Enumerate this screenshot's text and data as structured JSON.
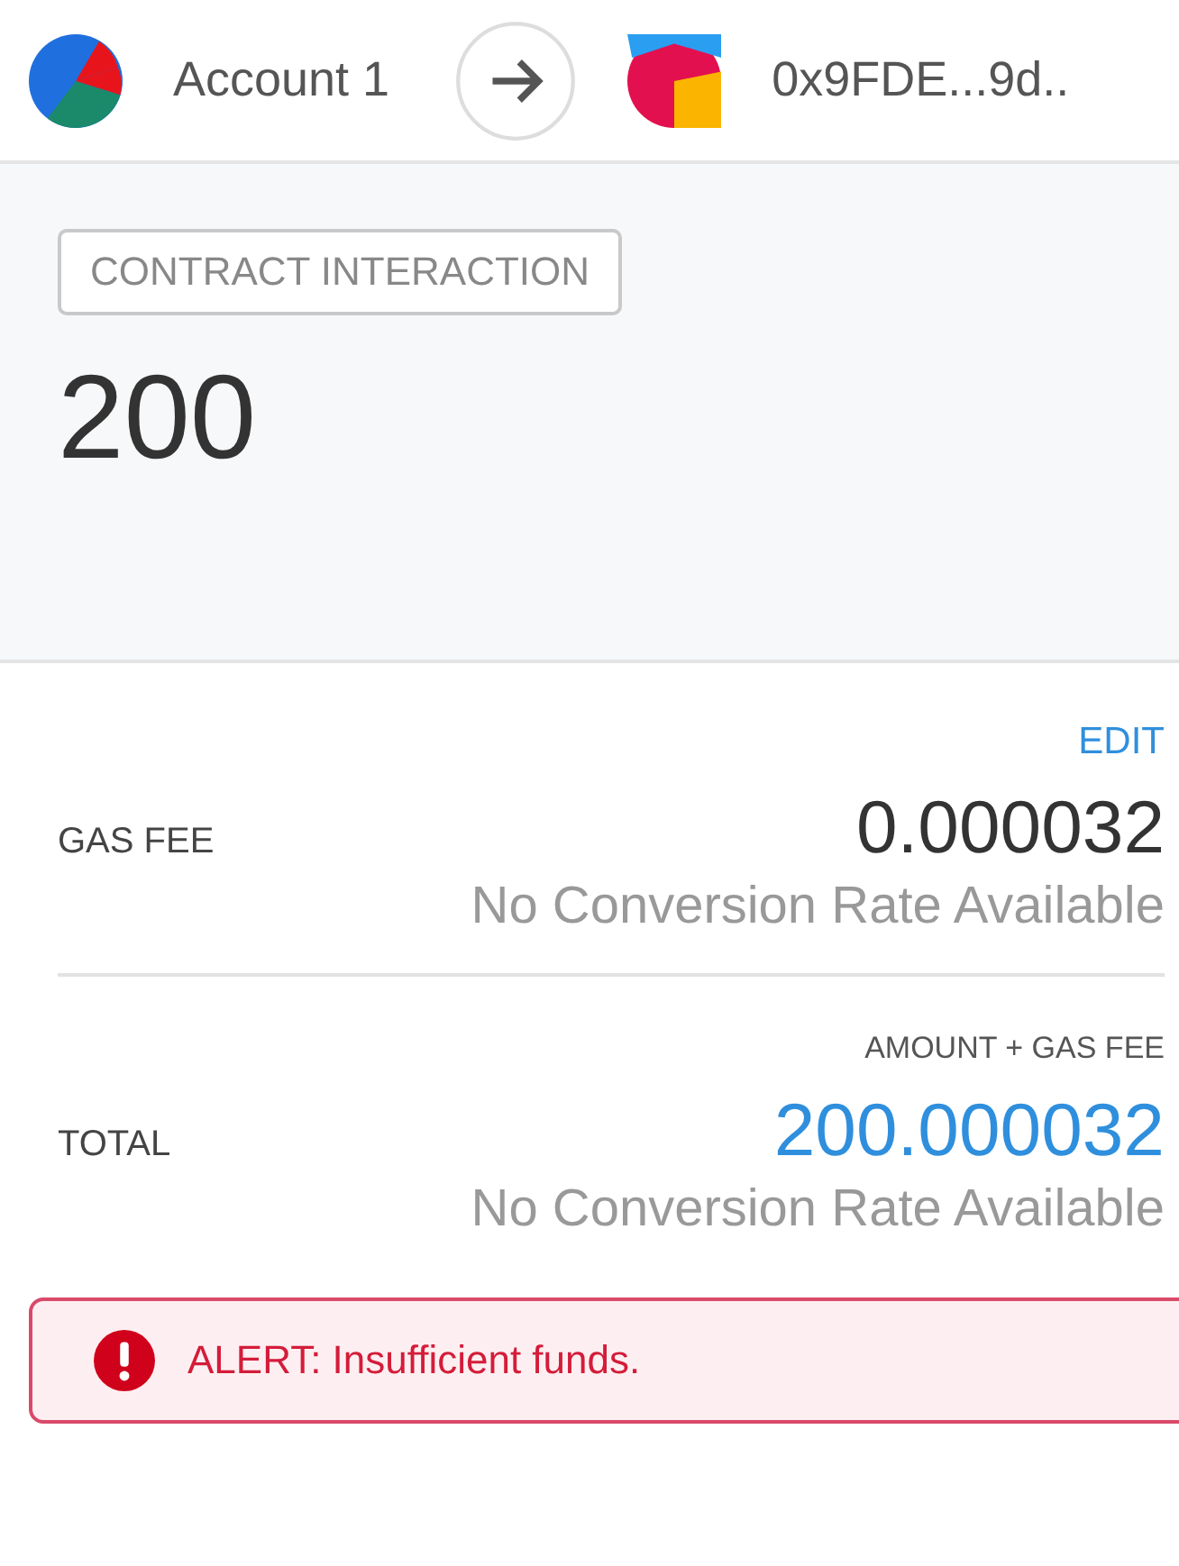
{
  "header": {
    "sender": {
      "name": "Account 1"
    },
    "recipient": {
      "name": "0x9FDE...9d.."
    }
  },
  "summary": {
    "tag": "CONTRACT INTERACTION",
    "amount": "200"
  },
  "edit_link": "EDIT",
  "rows": [
    {
      "kind": "fee",
      "label": "GAS FEE",
      "value": "0.000032",
      "secondary": "No Conversion Rate Available"
    },
    {
      "kind": "total",
      "heading": "AMOUNT + GAS FEE",
      "label": "TOTAL",
      "value": "200.000032",
      "secondary": "No Conversion Rate Available"
    }
  ],
  "alert": {
    "prefix": "ALERT:",
    "message": "Insufficient funds."
  }
}
